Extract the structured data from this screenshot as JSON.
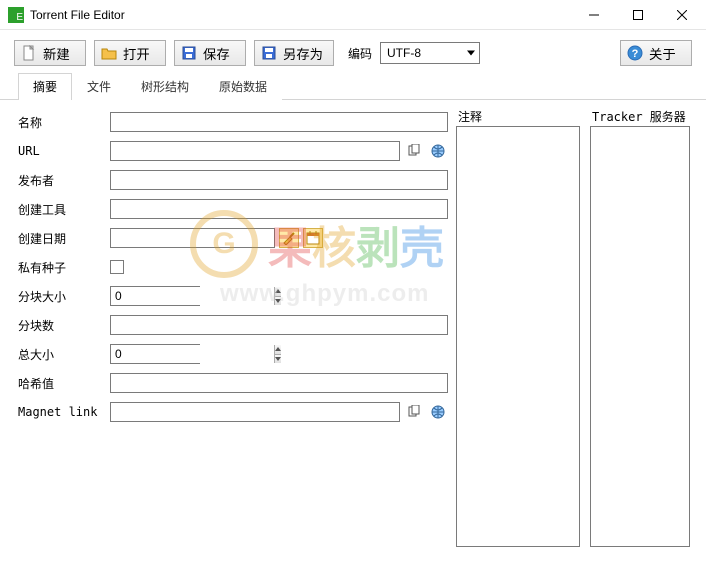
{
  "window": {
    "title": "Torrent File Editor"
  },
  "toolbar": {
    "new_label": "新建",
    "open_label": "打开",
    "save_label": "保存",
    "saveas_label": "另存为",
    "encoding_label": "编码",
    "encoding_value": "UTF-8",
    "about_label": "关于"
  },
  "tabs": [
    {
      "label": "摘要",
      "active": true
    },
    {
      "label": "文件",
      "active": false
    },
    {
      "label": "树形结构",
      "active": false
    },
    {
      "label": "原始数据",
      "active": false
    }
  ],
  "form": {
    "name_label": "名称",
    "name_value": "",
    "url_label": "URL",
    "url_value": "",
    "publisher_label": "发布者",
    "publisher_value": "",
    "tool_label": "创建工具",
    "tool_value": "",
    "date_label": "创建日期",
    "date_value": "",
    "private_label": "私有种子",
    "private_checked": false,
    "piece_size_label": "分块大小",
    "piece_size_value": "0",
    "pieces_label": "分块数",
    "pieces_value": "",
    "total_size_label": "总大小",
    "total_size_value": "0",
    "hash_label": "哈希值",
    "hash_value": "",
    "magnet_label": "Magnet link",
    "magnet_value": ""
  },
  "side": {
    "comment_label": "注释",
    "trackers_label": "Tracker 服务器"
  },
  "watermark": {
    "chars": [
      "果",
      "核",
      "剥",
      "壳"
    ],
    "url": "www.ghpym.com"
  }
}
